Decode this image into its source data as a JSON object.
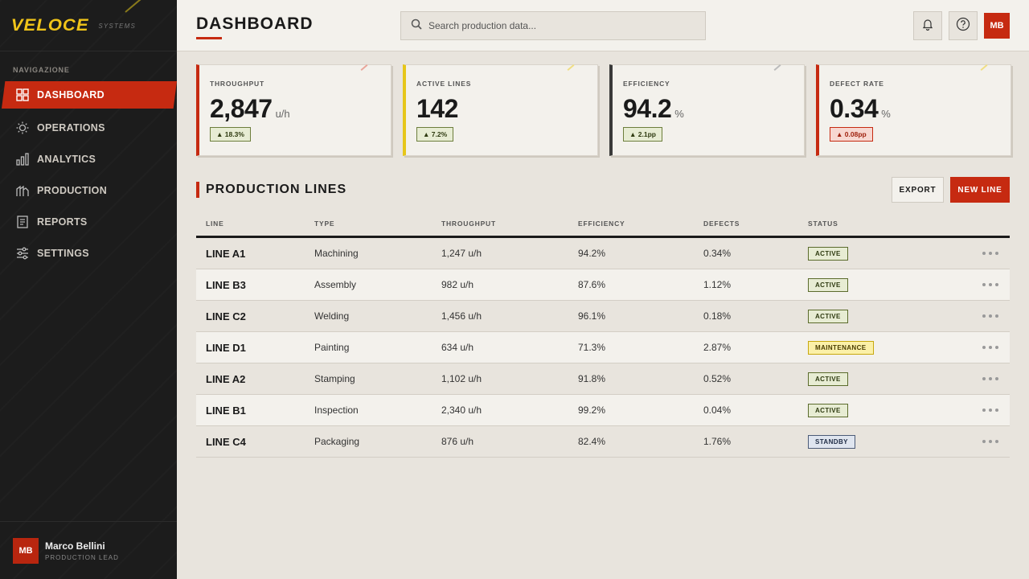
{
  "brand": {
    "name": "VELOCE",
    "sub": "SYSTEMS"
  },
  "sidebar": {
    "heading": "NAVIGAZIONE",
    "items": [
      {
        "label": "DASHBOARD",
        "icon": "grid-icon",
        "active": true
      },
      {
        "label": "OPERATIONS",
        "icon": "sun-gear-icon"
      },
      {
        "label": "ANALYTICS",
        "icon": "bar-chart-icon"
      },
      {
        "label": "PRODUCTION",
        "icon": "factory-icon"
      },
      {
        "label": "REPORTS",
        "icon": "document-icon"
      },
      {
        "label": "SETTINGS",
        "icon": "sliders-icon"
      }
    ],
    "user": {
      "initials": "MB",
      "name": "Marco Bellini",
      "role": "PRODUCTION LEAD"
    }
  },
  "header": {
    "title": "DASHBOARD",
    "search_placeholder": "Search production data...",
    "avatar_initials": "MB"
  },
  "kpis": [
    {
      "label": "THROUGHPUT",
      "value": "2,847",
      "unit": "u/h",
      "trend": "▲  18.3%",
      "trend_status": "good",
      "accent": "#c62a11"
    },
    {
      "label": "ACTIVE LINES",
      "value": "142",
      "unit": "",
      "trend": "▲  7.2%",
      "trend_status": "good",
      "accent": "#e6c619"
    },
    {
      "label": "EFFICIENCY",
      "value": "94.2",
      "unit": "%",
      "trend": "▲  2.1pp",
      "trend_status": "good",
      "accent": "#3a3a3a"
    },
    {
      "label": "DEFECT RATE",
      "value": "0.34",
      "unit": "%",
      "trend": "▲  0.08pp",
      "trend_status": "bad",
      "accent": "#c62a11"
    }
  ],
  "section": {
    "title": "PRODUCTION LINES",
    "export_label": "EXPORT",
    "new_label": "NEW LINE"
  },
  "table": {
    "columns": [
      "LINE",
      "TYPE",
      "THROUGHPUT",
      "EFFICIENCY",
      "DEFECTS",
      "STATUS"
    ],
    "rows": [
      {
        "line": "LINE A1",
        "type": "Machining",
        "throughput": "1,247 u/h",
        "efficiency": "94.2%",
        "defects": "0.34%",
        "status": "ACTIVE"
      },
      {
        "line": "LINE B3",
        "type": "Assembly",
        "throughput": "982 u/h",
        "efficiency": "87.6%",
        "defects": "1.12%",
        "status": "ACTIVE"
      },
      {
        "line": "LINE C2",
        "type": "Welding",
        "throughput": "1,456 u/h",
        "efficiency": "96.1%",
        "defects": "0.18%",
        "status": "ACTIVE"
      },
      {
        "line": "LINE D1",
        "type": "Painting",
        "throughput": "634 u/h",
        "efficiency": "71.3%",
        "defects": "2.87%",
        "status": "MAINTENANCE"
      },
      {
        "line": "LINE A2",
        "type": "Stamping",
        "throughput": "1,102 u/h",
        "efficiency": "91.8%",
        "defects": "0.52%",
        "status": "ACTIVE"
      },
      {
        "line": "LINE B1",
        "type": "Inspection",
        "throughput": "2,340 u/h",
        "efficiency": "99.2%",
        "defects": "0.04%",
        "status": "ACTIVE"
      },
      {
        "line": "LINE C4",
        "type": "Packaging",
        "throughput": "876 u/h",
        "efficiency": "82.4%",
        "defects": "1.76%",
        "status": "STANDBY"
      }
    ]
  }
}
